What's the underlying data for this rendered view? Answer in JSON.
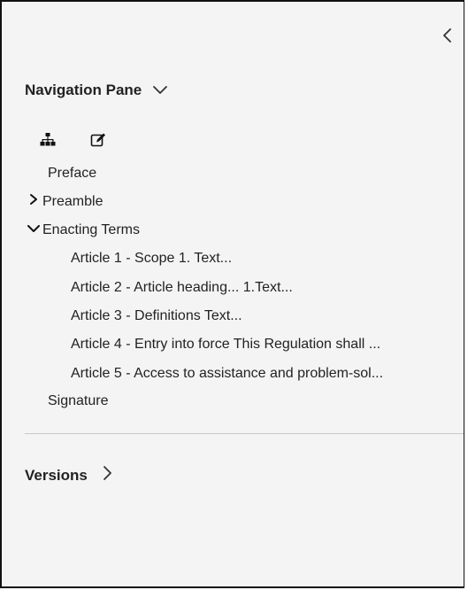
{
  "nav_pane": {
    "title": "Navigation Pane",
    "collapse_icon": "chevron-left-icon",
    "toggle_icon": "chevron-down-icon",
    "tools": [
      {
        "name": "tree-structure-icon"
      },
      {
        "name": "edit-icon"
      }
    ],
    "tree": {
      "preface": "Preface",
      "preamble": "Preamble",
      "enacting_terms": "Enacting Terms",
      "articles": [
        "Article 1 - Scope 1. Text...",
        "Article 2 - Article heading... 1.Text...",
        "Article 3 - Definitions Text...",
        "Article 4 - Entry into force This Regulation shall ...",
        "Article 5 - Access to assistance and problem-sol..."
      ],
      "signature": "Signature"
    }
  },
  "versions": {
    "title": "Versions",
    "toggle_icon": "chevron-right-icon"
  }
}
